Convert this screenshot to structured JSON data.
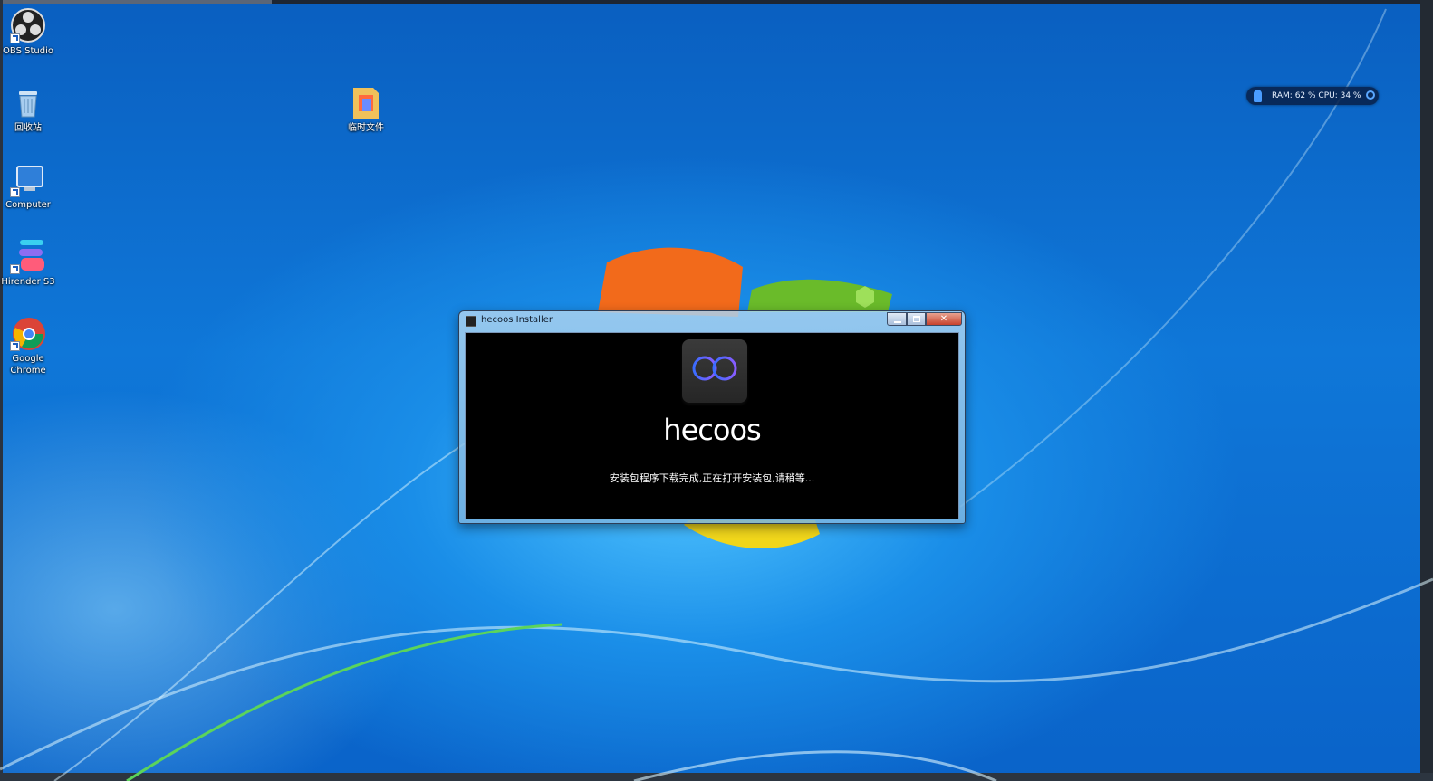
{
  "desktop": {
    "icons": [
      {
        "label": "OBS Studio"
      },
      {
        "label": "回收站"
      },
      {
        "label": "Computer"
      },
      {
        "label": "Hirender S3"
      },
      {
        "label": "Google\nChrome"
      },
      {
        "label": "临时文件"
      }
    ],
    "widget": {
      "text": "RAM: 62 %  CPU: 34 %"
    }
  },
  "installer": {
    "title": "hecoos Installer",
    "brand": "hecoos",
    "status": "安装包程序下载完成,正在打开安装包,请稍等..."
  },
  "colors": {
    "accent_blue": "#3a6cff",
    "accent_purple": "#8a5cff"
  }
}
